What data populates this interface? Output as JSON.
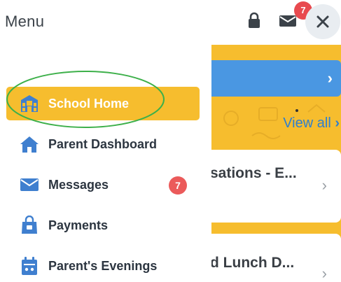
{
  "menu": {
    "title": "Menu",
    "items": [
      {
        "label": "School Home",
        "icon": "school-icon",
        "active": true
      },
      {
        "label": "Parent Dashboard",
        "icon": "home-icon"
      },
      {
        "label": "Messages",
        "icon": "envelope-icon",
        "badge": "7"
      },
      {
        "label": "Payments",
        "icon": "shopping-bag-icon"
      },
      {
        "label": "Parent's Evenings",
        "icon": "calendar-icon"
      }
    ]
  },
  "header": {
    "mail_badge": "7",
    "icons": [
      "lock-icon",
      "mail-icon",
      "close-icon"
    ]
  },
  "background": {
    "view_all": "View all",
    "cards": [
      {
        "title": "sations - E..."
      },
      {
        "title": "d Lunch D..."
      }
    ]
  },
  "colors": {
    "accent": "#f6bd2e",
    "blue": "#4a97e2",
    "badge": "#eb5a5a",
    "highlight": "#3db04a"
  }
}
